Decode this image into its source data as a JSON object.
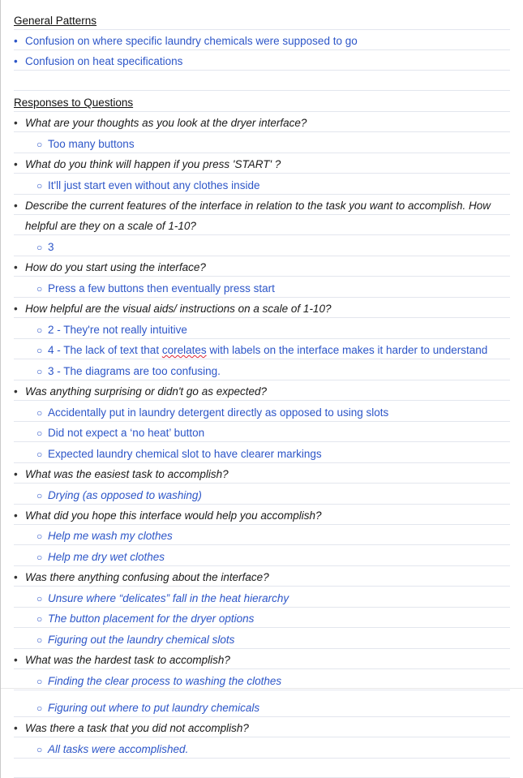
{
  "general_patterns": {
    "heading": "General Patterns",
    "items": [
      "Confusion on where specific laundry chemicals were supposed to go",
      "Confusion on heat specifications"
    ]
  },
  "responses": {
    "heading": "Responses to Questions",
    "q1": {
      "text": "What are your thoughts as you look at the dryer interface?",
      "a1": "Too many buttons"
    },
    "q2": {
      "text": "What do you think will happen if you press 'START' ?",
      "a1": "It'll just start even without any clothes inside"
    },
    "q3": {
      "text": "Describe the current features of the interface in relation to the task you want to accomplish. How",
      "text2": "helpful are they on a scale of 1-10?",
      "a1": "3"
    },
    "q4": {
      "text": "How do you start using the interface?",
      "a1": "Press a few buttons then eventually press start"
    },
    "q5": {
      "text": "How helpful are the visual aids/ instructions on a scale of 1-10?",
      "a1": "2 - They're not really intuitive",
      "a2_pre": "4 - The lack of text that ",
      "a2_word": "corelates",
      "a2_post": " with labels on the interface makes it harder to understand",
      "a3": "3 - The diagrams are too confusing."
    },
    "q6": {
      "text": "Was anything surprising or didn't go as expected?",
      "a1": "Accidentally put in laundry detergent directly as opposed to using slots",
      "a2": "Did not expect a ‘no heat’ button",
      "a3": "Expected laundry chemical slot to have clearer markings"
    },
    "q7": {
      "text": "What was the easiest task to accomplish?",
      "a1": "Drying (as opposed to washing)"
    },
    "q8": {
      "text": "What did you hope this interface would help you accomplish?",
      "a1": "Help me wash my clothes",
      "a2": "Help me dry wet clothes"
    },
    "q9": {
      "text": "Was there anything confusing about the interface?",
      "a1": "Unsure where “delicates” fall in the heat hierarchy",
      "a2": "The button placement for the dryer options",
      "a3": "Figuring out the laundry chemical slots"
    },
    "q10": {
      "text": "What was the hardest task to accomplish?",
      "a1": "Finding the clear process to washing the clothes",
      "a2": "Figuring out where to put laundry chemicals"
    },
    "q11": {
      "text": "Was there a task that you did not accomplish?",
      "a1": "All tasks were accomplished."
    }
  },
  "markers": {
    "bullet": "•",
    "sub_bullet": "○"
  },
  "colors": {
    "answer_blue": "#2d56c8",
    "rule_line": "#e3e6ee"
  }
}
